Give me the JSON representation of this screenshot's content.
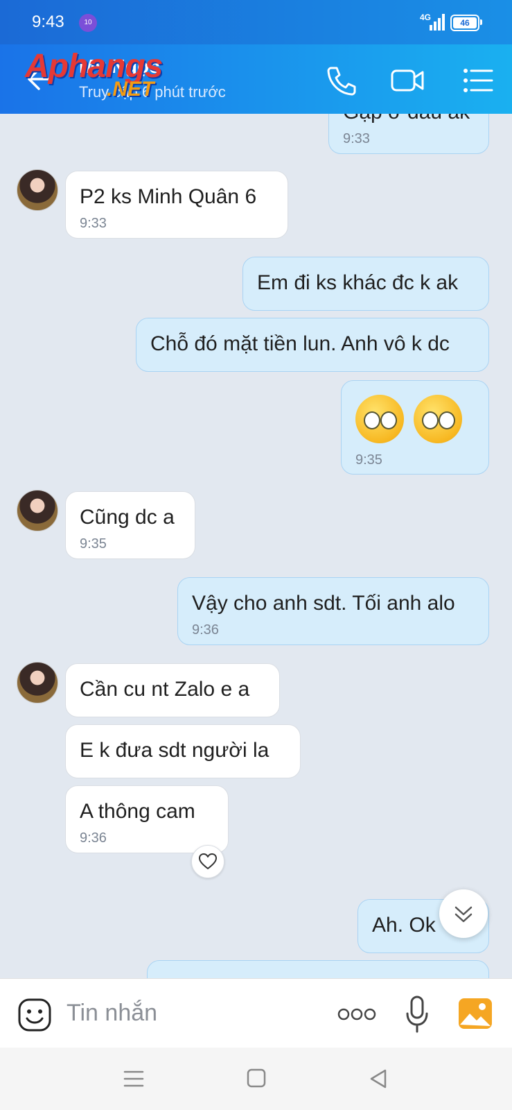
{
  "status_bar": {
    "time": "9:43",
    "notification_badge": "10",
    "network": "4G",
    "battery": "46"
  },
  "header": {
    "contact_name": "My Ngọc",
    "subtitle": "Truy cập 6 phút trước",
    "watermark_top": "Aphangs",
    "watermark_bottom": ".NET",
    "icons": [
      "back-arrow-icon",
      "phone-icon",
      "video-call-icon",
      "menu-list-icon"
    ]
  },
  "messages": [
    {
      "direction": "out",
      "text": "Gặp ở đâu ak",
      "time": "9:33"
    },
    {
      "direction": "in",
      "text": "P2 ks Minh Quân 6",
      "time": "9:33"
    },
    {
      "direction": "out",
      "text": "Em đi ks khác đc k ak",
      "time": ""
    },
    {
      "direction": "out",
      "text": "Chỗ đó mặt tiền lun. Anh vô k dc",
      "time": ""
    },
    {
      "direction": "out",
      "text": "🥺🥺",
      "time": "9:35"
    },
    {
      "direction": "in",
      "text": "Cũng dc a",
      "time": "9:35"
    },
    {
      "direction": "out",
      "text": "Vậy cho anh sdt. Tối anh alo",
      "time": "9:36"
    },
    {
      "direction": "in",
      "text": "Cần cu nt Zalo e a",
      "time": ""
    },
    {
      "direction": "in",
      "text": "E k đưa sdt người la",
      "time": ""
    },
    {
      "direction": "in",
      "text": "A thông cam",
      "time": "9:36"
    },
    {
      "direction": "out",
      "text": "Ah. Ok",
      "time": ""
    }
  ],
  "input_bar": {
    "placeholder": "Tin nhắn"
  },
  "colors": {
    "header_start": "#1a73e8",
    "header_end": "#1ab0f0",
    "outgoing_bubble": "#d6edfb",
    "incoming_bubble": "#ffffff",
    "chat_background": "#e2e8f0"
  }
}
